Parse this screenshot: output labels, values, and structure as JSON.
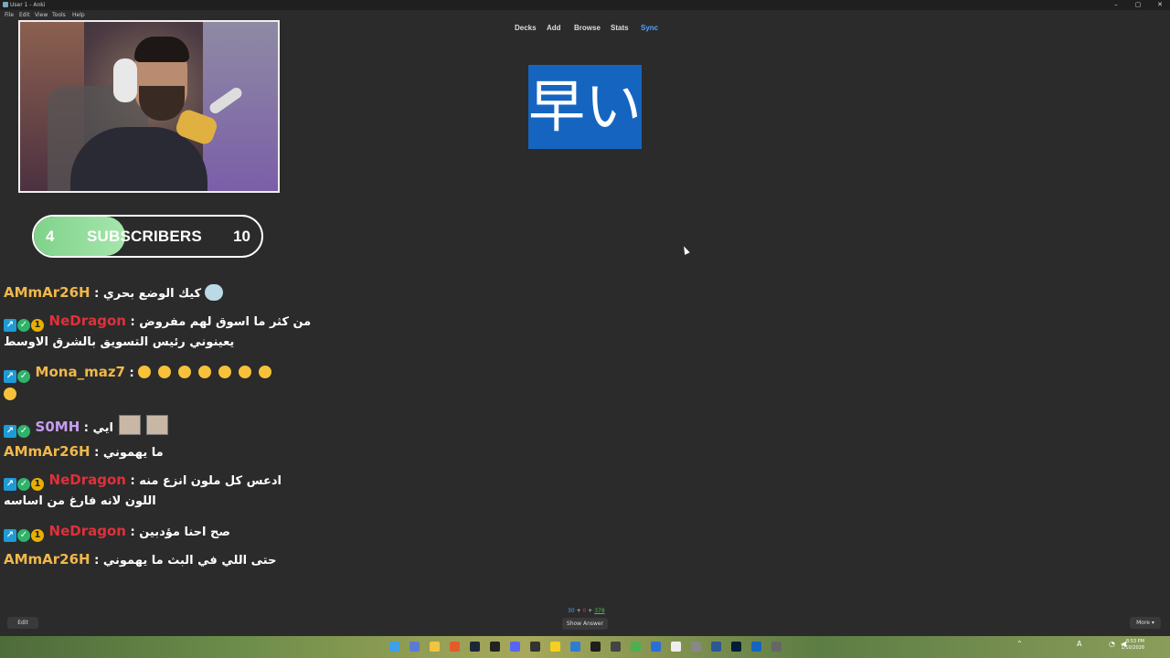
{
  "window": {
    "title": "User 1 - Anki",
    "minimize": "–",
    "maximize": "▢",
    "close": "✕"
  },
  "menu": [
    "File",
    "Edit",
    "View",
    "Tools",
    "Help"
  ],
  "subscribers": {
    "current": "4",
    "label": "SUBSCRIBERS",
    "goal": "10",
    "progress": 0.4
  },
  "chat": [
    {
      "user": "AMmAr26H",
      "user_color": "#f0b84a",
      "badges": [],
      "text": "كيك الوضع بحري :",
      "line2": ""
    },
    {
      "user": "NeDragon",
      "user_color": "#e0303a",
      "badges": [
        "vip",
        "verified",
        "one"
      ],
      "text": "من كثر ما اسوق لهم مفروض :",
      "line2": "يعينوني رئيس التسويق بالشرق الاوسط"
    },
    {
      "user": "Mona_maz7",
      "user_color": "#f0b84a",
      "badges": [
        "vip",
        "verified"
      ],
      "text": ":",
      "line2": ""
    },
    {
      "user": "S0MH",
      "user_color": "#c79cf0",
      "badges": [
        "vip",
        "verified"
      ],
      "text": "ايي :",
      "line2": ""
    },
    {
      "user": "AMmAr26H",
      "user_color": "#f0b84a",
      "badges": [],
      "text": "ما يهموني :",
      "line2": ""
    },
    {
      "user": "NeDragon",
      "user_color": "#e0303a",
      "badges": [
        "vip",
        "verified",
        "one"
      ],
      "text": "ادعس كل ملون انزع منه :",
      "line2": "اللون لانه فارغ من اساسه"
    },
    {
      "user": "NeDragon",
      "user_color": "#e0303a",
      "badges": [
        "vip",
        "verified",
        "one"
      ],
      "text": "صح احنا مؤدبين :",
      "line2": ""
    },
    {
      "user": "AMmAr26H",
      "user_color": "#f0b84a",
      "badges": [],
      "text": "حتى اللي في البث ما يهموني :",
      "line2": ""
    }
  ],
  "nav": {
    "decks": "Decks",
    "add": "Add",
    "browse": "Browse",
    "stats": "Stats",
    "sync": "Sync",
    "sync_color": "#4fa3ff"
  },
  "card": {
    "front": "早い",
    "bg": "#1565c0"
  },
  "counts": {
    "new": "30",
    "sep1": "+",
    "learn": "0",
    "sep2": "+",
    "review": "378",
    "new_color": "#4fa3ff",
    "learn_color": "#e0303a",
    "review_color": "#4cc04c"
  },
  "buttons": {
    "edit": "Edit",
    "show_answer": "Show Answer",
    "more": "More ▾"
  },
  "clock": {
    "time": "8:53 PM",
    "date": "1/10/2026"
  }
}
